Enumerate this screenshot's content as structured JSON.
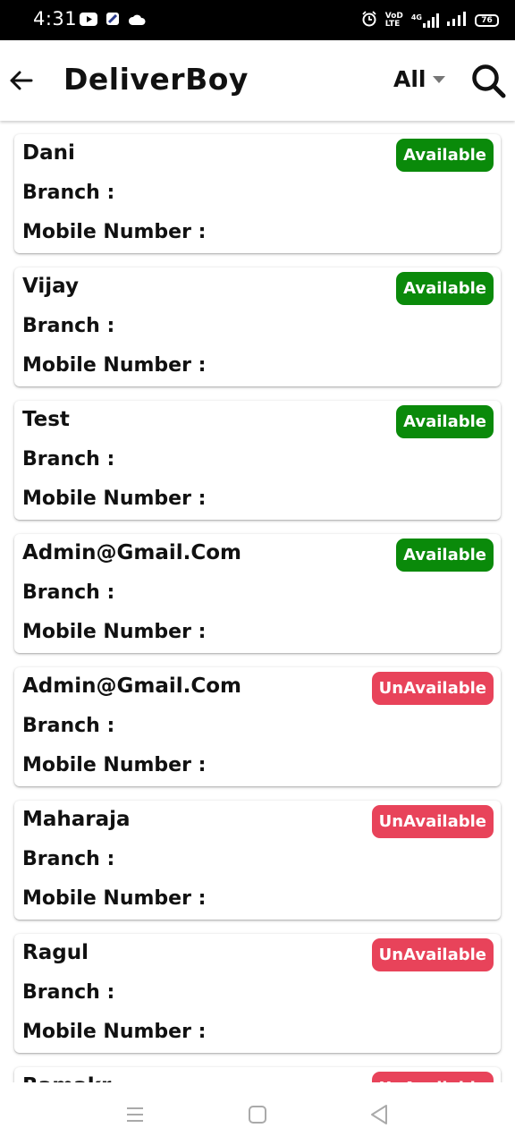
{
  "status_bar": {
    "time": "4:31",
    "net_label_top": "VoD",
    "net_label_bottom": "LTE",
    "net_type": "4G",
    "battery": "76",
    "icons": [
      "youtube-icon",
      "app-icon",
      "cloud-icon",
      "alarm-icon",
      "signal-icon",
      "signal-icon-2",
      "battery-icon"
    ]
  },
  "appbar": {
    "title": "DeliverBoy",
    "filter_value": "All",
    "icons": [
      "back-arrow-icon",
      "dropdown-caret-icon",
      "search-icon"
    ]
  },
  "labels": {
    "branch": "Branch :",
    "mobile": "Mobile Number :"
  },
  "colors": {
    "available": "#0a8a0a",
    "unavailable": "#e8435a"
  },
  "delivery_boys": [
    {
      "name": "Dani",
      "status": "Available"
    },
    {
      "name": "Vijay",
      "status": "Available"
    },
    {
      "name": "Test",
      "status": "Available"
    },
    {
      "name": "Admin@Gmail.Com",
      "status": "Available"
    },
    {
      "name": "Admin@Gmail.Com",
      "status": "UnAvailable"
    },
    {
      "name": "Maharaja",
      "status": "UnAvailable"
    },
    {
      "name": "Ragul",
      "status": "UnAvailable"
    },
    {
      "name": "Ramakr",
      "status": "UnAvailable"
    }
  ],
  "nav_bar": {
    "icons": [
      "menu-icon",
      "home-square-icon",
      "back-triangle-icon"
    ]
  }
}
